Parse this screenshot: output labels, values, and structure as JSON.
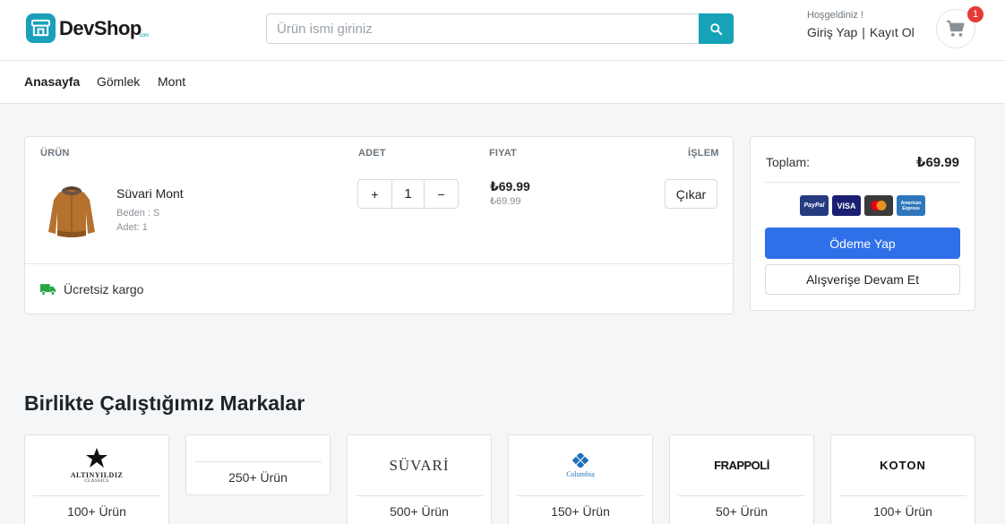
{
  "header": {
    "logo_text": "DevShop",
    "logo_suffix": ".com",
    "search_placeholder": "Ürün ismi giriniz",
    "greeting": "Hoşgeldiniz !",
    "login_label": "Giriş Yap",
    "separator": "|",
    "register_label": "Kayıt Ol",
    "cart_count": "1"
  },
  "nav": {
    "items": [
      {
        "label": "Anasayfa",
        "active": true
      },
      {
        "label": "Gömlek",
        "active": false
      },
      {
        "label": "Mont",
        "active": false
      }
    ]
  },
  "cart": {
    "columns": {
      "product": "ÜRÜN",
      "quantity": "ADET",
      "price": "FIYAT",
      "action": "İŞLEM"
    },
    "items": [
      {
        "name": "Süvari Mont",
        "size": "Beden : S",
        "qty_label": "Adet: 1",
        "quantity": "1",
        "price": "₺69.99",
        "price_small": "₺69.99",
        "remove_label": "Çıkar"
      }
    ],
    "plus": "+",
    "minus": "−",
    "shipping_text": "Ücretsiz kargo"
  },
  "summary": {
    "total_label": "Toplam:",
    "total_value": "₺69.99",
    "payment_methods": [
      "PayPal",
      "VISA",
      "Mastercard",
      "American Express"
    ],
    "pay_label": "Ödeme Yap",
    "continue_label": "Alışverişe Devam Et"
  },
  "brands": {
    "title": "Birlikte Çalıştığımız Markalar",
    "items": [
      {
        "name": "ALTINYILDIZ",
        "sub": "CLASSICS",
        "count": "100+ Ürün"
      },
      {
        "name": "",
        "sub": "",
        "count": "250+ Ürün"
      },
      {
        "name": "SÜVARİ",
        "sub": "",
        "count": "500+ Ürün"
      },
      {
        "name": "Columbia",
        "sub": "",
        "count": "150+ Ürün"
      },
      {
        "name": "FRAPPOLİ",
        "sub": "",
        "count": "50+ Ürün"
      },
      {
        "name": "KOTON",
        "sub": "",
        "count": "100+ Ürün"
      }
    ]
  },
  "colors": {
    "accent": "#17a2b8",
    "primary_button": "#2f6fe8",
    "badge": "#e53935",
    "shipping_icon": "#28a745"
  }
}
